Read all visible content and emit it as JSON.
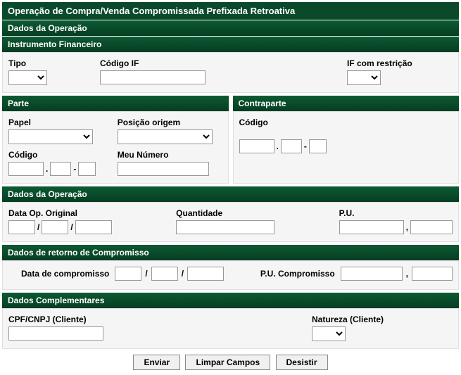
{
  "title": "Operação de Compra/Venda Compromissada Prefixada Retroativa",
  "sections": {
    "dados_operacao": "Dados da Operação",
    "instrumento": "Instrumento Financeiro",
    "parte": "Parte",
    "contraparte": "Contraparte",
    "dados_operacao2": "Dados da Operação",
    "retorno": "Dados de retorno de Compromisso",
    "complementares": "Dados Complementares"
  },
  "labels": {
    "tipo": "Tipo",
    "codigo_if": "Código IF",
    "if_restricao": "IF com restrição",
    "papel": "Papel",
    "posicao_origem": "Posição origem",
    "codigo": "Código",
    "meu_numero": "Meu Número",
    "contraparte_codigo": "Código",
    "data_op_original": "Data Op. Original",
    "quantidade": "Quantidade",
    "pu": "P.U.",
    "data_compromisso": "Data de compromisso",
    "pu_compromisso": "P.U. Compromisso",
    "cpf_cnpj": "CPF/CNPJ (Cliente)",
    "natureza": "Natureza (Cliente)"
  },
  "buttons": {
    "enviar": "Enviar",
    "limpar": "Limpar Campos",
    "desistir": "Desistir"
  },
  "sep": {
    "dot": ".",
    "dash": "-",
    "slash": "/",
    "comma": ","
  }
}
